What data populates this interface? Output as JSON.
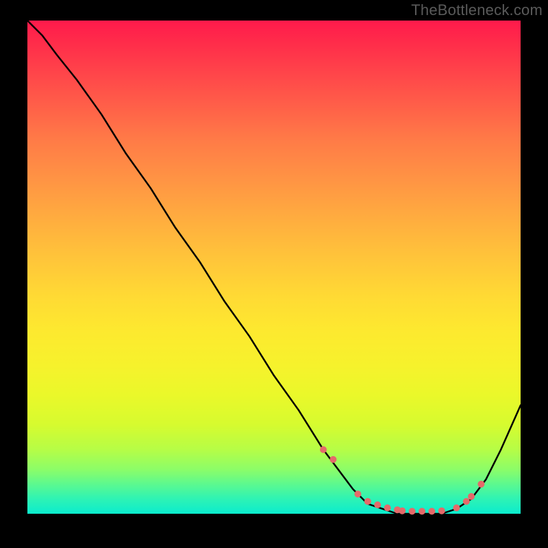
{
  "watermark": "TheBottleneck.com",
  "chart_data": {
    "type": "line",
    "title": "",
    "xlabel": "",
    "ylabel": "",
    "xlim": [
      0,
      100
    ],
    "ylim": [
      0,
      100
    ],
    "grid": false,
    "note": "Bottleneck curve rendered on red→green vertical gradient. y = mismatch (100 top = worst, 0 bottom = best). Curve path (x%, y%) read off pixels:",
    "series": [
      {
        "name": "bottleneck-curve",
        "x": [
          0,
          3,
          6,
          10,
          15,
          20,
          25,
          30,
          35,
          40,
          45,
          50,
          55,
          60,
          63,
          66,
          69,
          72,
          75,
          78,
          81,
          84,
          87,
          90,
          93,
          96,
          100
        ],
        "y": [
          100,
          97,
          93,
          88,
          81,
          73,
          66,
          58,
          51,
          43,
          36,
          28,
          21,
          13,
          9,
          5,
          2,
          1,
          0,
          0,
          0,
          0,
          1,
          3,
          7,
          13,
          22
        ]
      }
    ],
    "markers_x": [
      60,
      62,
      67,
      69,
      71,
      73,
      75,
      76,
      78,
      80,
      82,
      84,
      87,
      89,
      90,
      92
    ],
    "markers_y": [
      13,
      11,
      4,
      2.5,
      1.8,
      1.2,
      0.8,
      0.6,
      0.5,
      0.5,
      0.5,
      0.6,
      1.2,
      2.5,
      3.5,
      6
    ],
    "marker_radius": 5
  },
  "colors": {
    "curve": "#000000",
    "marker": "#e46a6a",
    "gradient_top": "#ff1a4b",
    "gradient_bottom": "#0becce",
    "frame": "#000000"
  }
}
